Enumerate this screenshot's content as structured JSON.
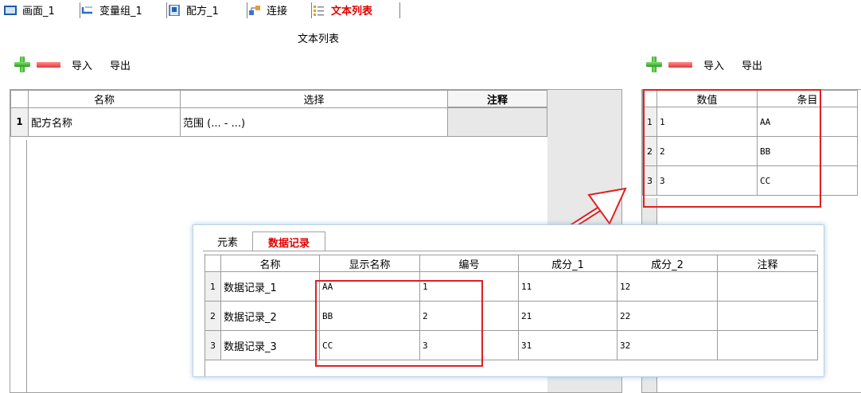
{
  "tabs": [
    {
      "label": "画面_1",
      "icon": "screen-icon"
    },
    {
      "label": "变量组_1",
      "icon": "variable-group-icon"
    },
    {
      "label": "配方_1",
      "icon": "recipe-icon"
    },
    {
      "label": "连接",
      "icon": "connection-icon"
    },
    {
      "label": "文本列表",
      "icon": "text-list-icon",
      "active": true
    }
  ],
  "page_title": "文本列表",
  "toolbar": {
    "import_label": "导入",
    "export_label": "导出"
  },
  "left_grid": {
    "headers": [
      "名称",
      "选择",
      "注释"
    ],
    "rows": [
      {
        "num": "1",
        "name": "配方名称",
        "select": "范围 (... - ...)",
        "comment": ""
      }
    ]
  },
  "right_grid": {
    "headers": [
      "数值",
      "条目"
    ],
    "rows": [
      {
        "num": "1",
        "value": "1",
        "entry": "AA"
      },
      {
        "num": "2",
        "value": "2",
        "entry": "BB"
      },
      {
        "num": "3",
        "value": "3",
        "entry": "CC"
      }
    ]
  },
  "overlay": {
    "tabs": [
      "元素",
      "数据记录"
    ],
    "headers": [
      "名称",
      "显示名称",
      "编号",
      "成分_1",
      "成分_2",
      "注释"
    ],
    "rows": [
      {
        "num": "1",
        "name": "数据记录_1",
        "display": "AA",
        "number": "1",
        "c1": "11",
        "c2": "12",
        "comment": ""
      },
      {
        "num": "2",
        "name": "数据记录_2",
        "display": "BB",
        "number": "2",
        "c1": "21",
        "c2": "22",
        "comment": ""
      },
      {
        "num": "3",
        "name": "数据记录_3",
        "display": "CC",
        "number": "3",
        "c1": "31",
        "c2": "32",
        "comment": ""
      }
    ]
  },
  "colors": {
    "highlight": "#e02020",
    "active_tab": "#e00000"
  }
}
